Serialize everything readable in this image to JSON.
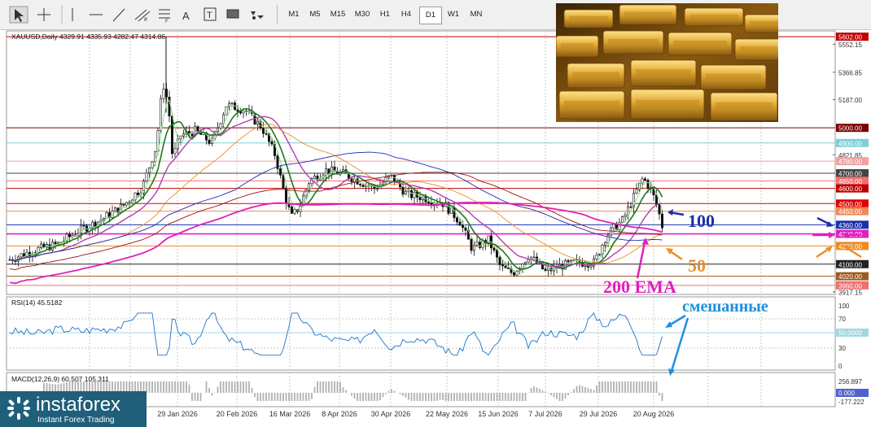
{
  "toolbar": {
    "tools": [
      {
        "name": "cursor-tool-icon"
      },
      {
        "name": "crosshair-tool-icon"
      },
      {
        "name": "vertical-line-tool-icon"
      },
      {
        "name": "horizontal-line-tool-icon"
      },
      {
        "name": "trendline-tool-icon"
      },
      {
        "name": "channel-tool-icon"
      },
      {
        "name": "fibonacci-tool-icon"
      },
      {
        "name": "text-tool-icon",
        "label": "A"
      },
      {
        "name": "text-label-tool-icon",
        "label": "T"
      },
      {
        "name": "rectangle-tool-icon"
      },
      {
        "name": "shapes-dropdown-icon"
      }
    ],
    "timeframes": [
      "M1",
      "M5",
      "M15",
      "M30",
      "H1",
      "H4",
      "D1",
      "W1",
      "MN"
    ],
    "active_timeframe": "D1"
  },
  "chart": {
    "symbol_info": "XAUUSD,Daily  4329.91 4335.93 4282.47 4314.86",
    "price_labels": [
      {
        "value": "5602.00",
        "price": 5602,
        "color": "#c00000"
      },
      {
        "value": "5552.15",
        "price": 5552,
        "color": ""
      },
      {
        "value": "5366.85",
        "price": 5367,
        "color": ""
      },
      {
        "value": "5187.00",
        "price": 5187,
        "color": ""
      },
      {
        "value": "5000.00",
        "price": 5000,
        "color": "#7a0000"
      },
      {
        "value": "4900.00",
        "price": 4900,
        "color": "#7fd0d8"
      },
      {
        "value": "4821.85",
        "price": 4822,
        "color": ""
      },
      {
        "value": "4780.00",
        "price": 4780,
        "color": "#f2a0a0"
      },
      {
        "value": "4700.00",
        "price": 4700,
        "color": "#444444"
      },
      {
        "value": "4650.00",
        "price": 4650,
        "color": "#f07070"
      },
      {
        "value": "4600.00",
        "price": 4600,
        "color": "#c00000"
      },
      {
        "value": "4500.00",
        "price": 4500,
        "color": "#e00000"
      },
      {
        "value": "4450.00",
        "price": 4450,
        "color": "#f08a5a"
      },
      {
        "value": "4360.00",
        "price": 4360,
        "color": "#1d2fa8"
      },
      {
        "value": "4300.00",
        "price": 4300,
        "color": "#e020c0"
      },
      {
        "value": "4220.00",
        "price": 4220,
        "color": "#f08a20"
      },
      {
        "value": "4100.00",
        "price": 4100,
        "color": "#222222"
      },
      {
        "value": "4020.00",
        "price": 4020,
        "color": "#a05a20"
      },
      {
        "value": "3960.00",
        "price": 3960,
        "color": "#f07070"
      },
      {
        "value": "3917.15",
        "price": 3917,
        "color": ""
      }
    ],
    "date_labels": [
      "29 Jan 2026",
      "20 Feb 2026",
      "16 Mar 2026",
      "8 Apr 2026",
      "30 Apr 2026",
      "22 May 2026",
      "15 Jun 2026",
      "7 Jul 2026",
      "29 Jul 2026",
      "20 Aug 2026"
    ],
    "rsi": {
      "label": "RSI(14) 45.5182",
      "levels": [
        "100",
        "70",
        "50.0000",
        "30",
        "0"
      ]
    },
    "macd": {
      "label": "MACD(12,26,9) 60.507 105.311",
      "levels": [
        "256.897",
        "0.000",
        "-177.222"
      ]
    },
    "annotations": {
      "ema100": "100",
      "ema50": "50",
      "ema200": "200 EMA",
      "mixed": "смешанные"
    },
    "colors": {
      "ema100": "#1d2fa8",
      "ema50": "#e8902a",
      "ema200": "#e020c0",
      "mixed": "#1e90e0",
      "candles": "#111111",
      "ma_fast": "#1b7a1b",
      "ma_slow": "#b040b0"
    }
  },
  "logo": {
    "name": "instaforex",
    "tagline": "Instant Forex Trading"
  }
}
